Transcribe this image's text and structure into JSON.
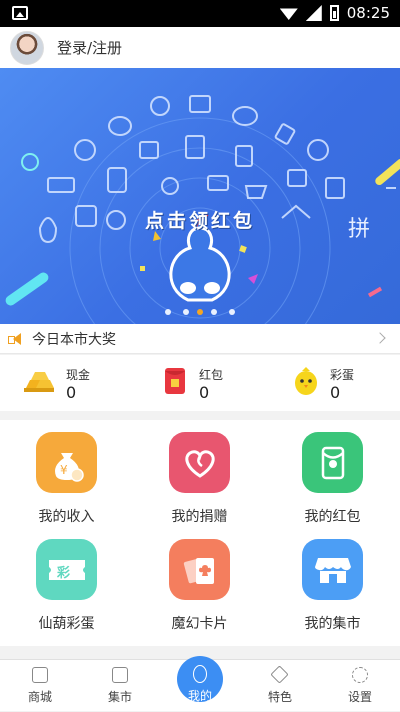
{
  "status_bar": {
    "time": "08:25"
  },
  "header": {
    "login_text": "登录/注册"
  },
  "banner": {
    "title": "点击领红包",
    "sign_text": "拼"
  },
  "notice": {
    "text": "今日本市大奖"
  },
  "wallet": [
    {
      "label": "现金",
      "value": "0",
      "icon": "gold-bars-icon"
    },
    {
      "label": "红包",
      "value": "0",
      "icon": "red-envelope-icon"
    },
    {
      "label": "彩蛋",
      "value": "0",
      "icon": "chick-egg-icon"
    }
  ],
  "grid": [
    {
      "label": "我的收入",
      "icon": "money-bag-icon",
      "color": "#f6a93b"
    },
    {
      "label": "我的捐赠",
      "icon": "heart-icon",
      "color": "#e8566f"
    },
    {
      "label": "我的红包",
      "icon": "red-envelope-icon",
      "color": "#3ac57a"
    },
    {
      "label": "仙葫彩蛋",
      "icon": "ticket-icon",
      "color": "#5fd8c0",
      "icon_text": "彩"
    },
    {
      "label": "魔幻卡片",
      "icon": "cards-icon",
      "color": "#f47e5e"
    },
    {
      "label": "我的集市",
      "icon": "store-icon",
      "color": "#4c9ef5"
    }
  ],
  "tabs": [
    {
      "label": "商城",
      "icon": "bag-icon"
    },
    {
      "label": "集市",
      "icon": "store-icon"
    },
    {
      "label": "我的",
      "icon": "gourd-icon",
      "active": true
    },
    {
      "label": "特色",
      "icon": "star-icon"
    },
    {
      "label": "设置",
      "icon": "gear-icon"
    }
  ],
  "colors": {
    "accent": "#3c8ef3",
    "banner": "#3b6fe3",
    "notice_icon": "#f0a020"
  }
}
